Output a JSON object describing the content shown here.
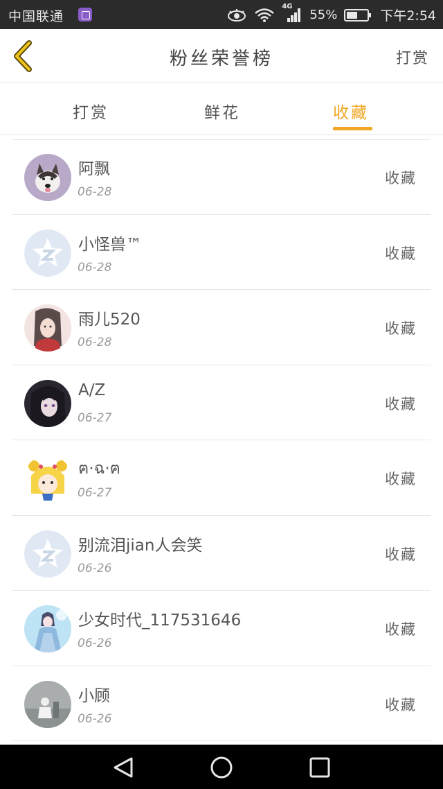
{
  "status_bar": {
    "carrier": "中国联通",
    "network": "4G",
    "battery": "55%",
    "battery_level": 0.55,
    "time": "下午2:54"
  },
  "header": {
    "title": "粉丝荣誉榜",
    "action_label": "打赏"
  },
  "tabs": [
    {
      "label": "打赏",
      "active": false
    },
    {
      "label": "鲜花",
      "active": false
    },
    {
      "label": "收藏",
      "active": true
    }
  ],
  "accent_color": "#f0a623",
  "entries": [
    {
      "name": "阿飘",
      "date": "06-28",
      "type": "收藏",
      "avatar": "husky-dog-photo"
    },
    {
      "name": "小怪兽™",
      "date": "06-28",
      "type": "收藏",
      "avatar": "default-qq-star-avatar"
    },
    {
      "name": "雨儿520",
      "date": "06-28",
      "type": "收藏",
      "avatar": "anime-girl-red-avatar"
    },
    {
      "name": "A/Z",
      "date": "06-27",
      "type": "收藏",
      "avatar": "anime-dark-hair-avatar"
    },
    {
      "name": "ฅ·ฉ·ฅ",
      "date": "06-27",
      "type": "收藏",
      "avatar": "sailor-moon-avatar"
    },
    {
      "name": "别流泪jian人会笑",
      "date": "06-26",
      "type": "收藏",
      "avatar": "default-qq-star-avatar"
    },
    {
      "name": "少女时代_117531646",
      "date": "06-26",
      "type": "收藏",
      "avatar": "blue-fairy-avatar"
    },
    {
      "name": "小顾",
      "date": "06-26",
      "type": "收藏",
      "avatar": "grey-scenery-avatar"
    }
  ]
}
